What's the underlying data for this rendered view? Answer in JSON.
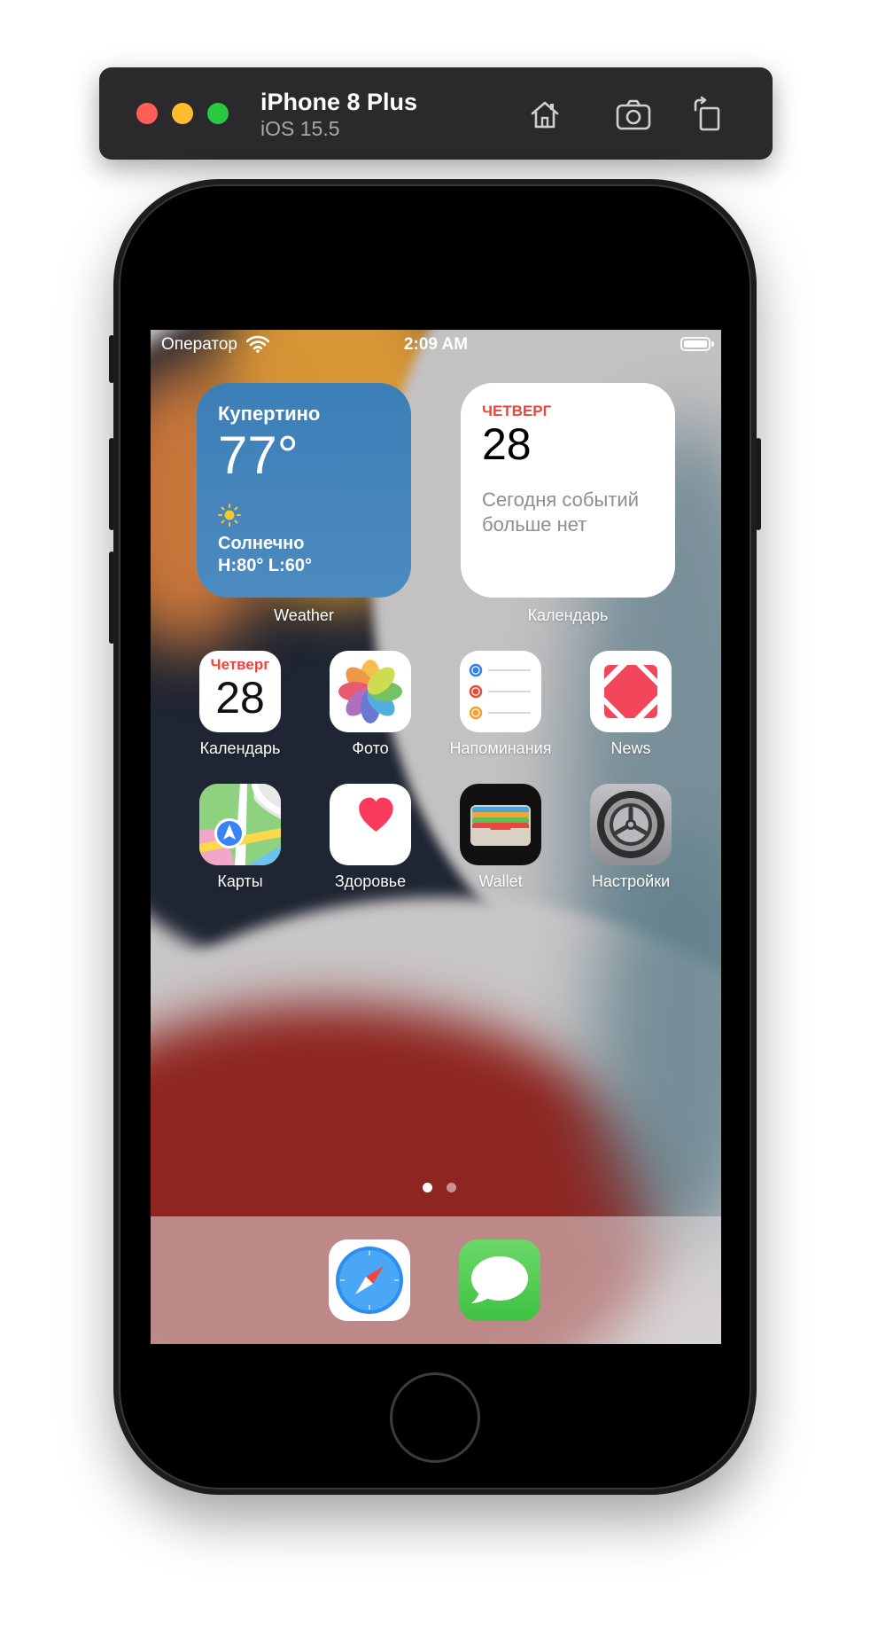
{
  "simulator": {
    "device_name": "iPhone 8 Plus",
    "os_version": "iOS 15.5",
    "buttons": [
      "home-icon",
      "screenshot-icon",
      "rotate-icon"
    ]
  },
  "status_bar": {
    "carrier": "Оператор",
    "time": "2:09 AM",
    "battery_level": 1.0
  },
  "widgets": {
    "weather": {
      "city": "Купертино",
      "temperature": "77°",
      "condition": "Солнечно",
      "range": "H:80° L:60°",
      "label": "Weather"
    },
    "calendar": {
      "day": "ЧЕТВЕРГ",
      "date": "28",
      "note": "Сегодня событий больше нет",
      "label": "Календарь"
    }
  },
  "apps": [
    {
      "label": "Календарь",
      "icon": "calendar-icon",
      "day": "Четверг",
      "date": "28"
    },
    {
      "label": "Фото",
      "icon": "photos-icon"
    },
    {
      "label": "Напоминания",
      "icon": "reminders-icon"
    },
    {
      "label": "News",
      "icon": "news-icon"
    },
    {
      "label": "Карты",
      "icon": "maps-icon"
    },
    {
      "label": "Здоровье",
      "icon": "health-icon"
    },
    {
      "label": "Wallet",
      "icon": "wallet-icon"
    },
    {
      "label": "Настройки",
      "icon": "settings-icon"
    }
  ],
  "page_indicator": {
    "pages": 2,
    "current": 1
  },
  "dock": [
    {
      "icon": "safari-icon"
    },
    {
      "icon": "messages-icon"
    }
  ],
  "colors": {
    "calendar_red": "#e8463e",
    "weather_blue": "#3c7eb7",
    "messages_green": "#4cd964"
  }
}
